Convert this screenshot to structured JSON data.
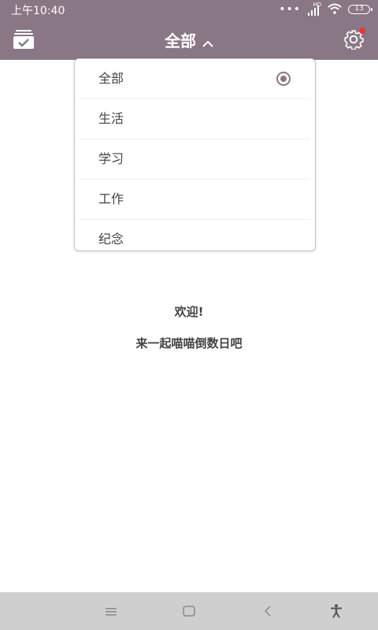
{
  "status_bar": {
    "time": "上午10:40",
    "dots": "•••",
    "network": "HD",
    "battery": "13"
  },
  "app_bar": {
    "title": "全部",
    "left_icon": "task-box-icon",
    "right_icon": "gear-icon"
  },
  "dropdown": {
    "items": [
      {
        "label": "全部",
        "selected": true
      },
      {
        "label": "生活",
        "selected": false
      },
      {
        "label": "学习",
        "selected": false
      },
      {
        "label": "工作",
        "selected": false
      },
      {
        "label": "纪念",
        "selected": false
      }
    ]
  },
  "empty_state": {
    "title": "欢迎!",
    "subtitle": "来一起喵喵倒数日吧"
  },
  "nav_bar": {
    "items": [
      "menu-icon",
      "home-icon",
      "back-icon",
      "accessibility-icon"
    ]
  },
  "colors": {
    "primary": "#8a7785",
    "notification": "#e33333"
  }
}
